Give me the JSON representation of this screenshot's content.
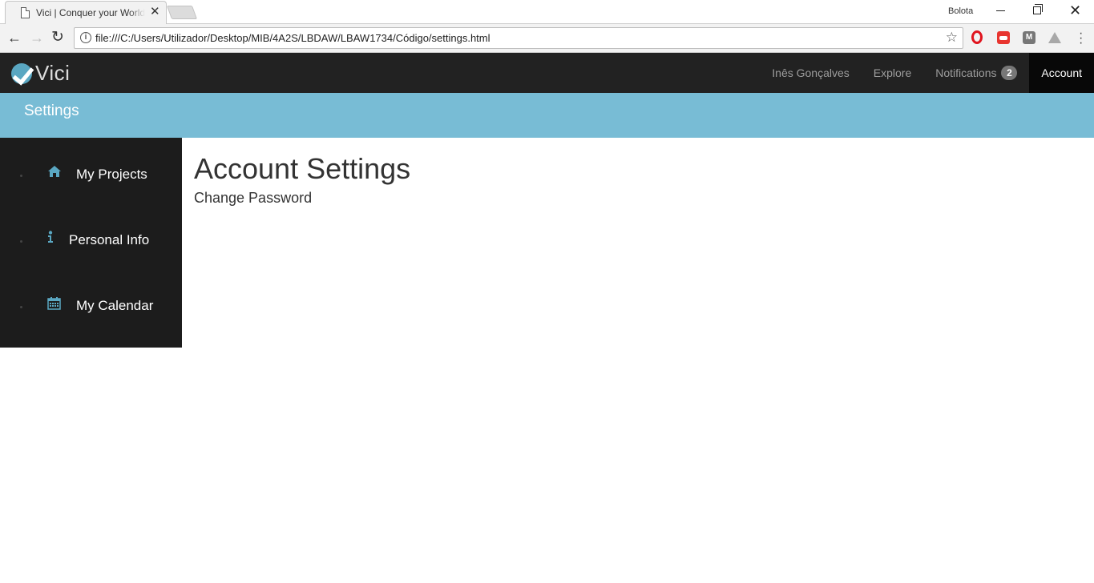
{
  "browser": {
    "tab_title": "Vici | Conquer your World",
    "profile_name": "Bolota",
    "url": "file:///C:/Users/Utilizador/Desktop/MIB/4A2S/LBDAW/LBAW1734/Código/settings.html"
  },
  "navbar": {
    "brand": "Vici",
    "links": [
      {
        "label": "Inês Gonçalves"
      },
      {
        "label": "Explore"
      },
      {
        "label": "Notifications",
        "badge": "2"
      },
      {
        "label": "Account"
      }
    ]
  },
  "title_bar": {
    "title": "Settings"
  },
  "sidebar": {
    "items": [
      {
        "label": "My Projects",
        "icon": "home-icon"
      },
      {
        "label": "Personal Info",
        "icon": "info-icon"
      },
      {
        "label": "My Calendar",
        "icon": "calendar-icon"
      }
    ]
  },
  "main": {
    "heading": "Account Settings",
    "link": "Change Password"
  },
  "colors": {
    "navbar": "#222222",
    "title_bar": "#78bcd5",
    "sidebar": "#1c1c1c",
    "icon_accent": "#5aa7c2"
  }
}
